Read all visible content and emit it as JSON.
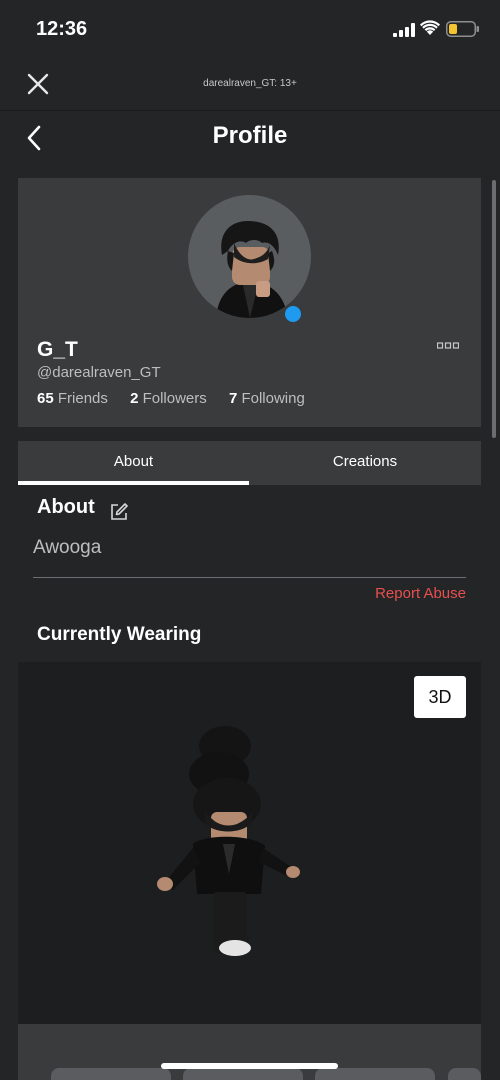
{
  "status_bar": {
    "time": "12:36",
    "icons": [
      "signal-icon",
      "wifi-icon",
      "battery-icon"
    ],
    "battery_color": "#f4c430"
  },
  "browser": {
    "title": "darealraven_GT: 13+",
    "close_icon": "close-icon"
  },
  "header": {
    "title": "Profile",
    "back_icon": "back-icon"
  },
  "profile": {
    "display_name": "G_T",
    "username": "@darealraven_GT",
    "online_color": "#1e9bf0",
    "more_icon": "more-icon",
    "stats": {
      "friends_count": "65",
      "friends_label": "Friends",
      "followers_count": "2",
      "followers_label": "Followers",
      "following_count": "7",
      "following_label": "Following"
    }
  },
  "tabs": [
    {
      "label": "About",
      "active": true
    },
    {
      "label": "Creations",
      "active": false
    }
  ],
  "about": {
    "heading": "About",
    "edit_icon": "edit-icon",
    "text": "Awooga",
    "report_label": "Report Abuse",
    "report_color": "#e8504f"
  },
  "wearing": {
    "heading": "Currently Wearing",
    "view_3d_label": "3D"
  },
  "colors": {
    "background": "#232527",
    "card": "#393b3d",
    "viewer": "#1d1e20",
    "accent": "#1e9bf0"
  }
}
